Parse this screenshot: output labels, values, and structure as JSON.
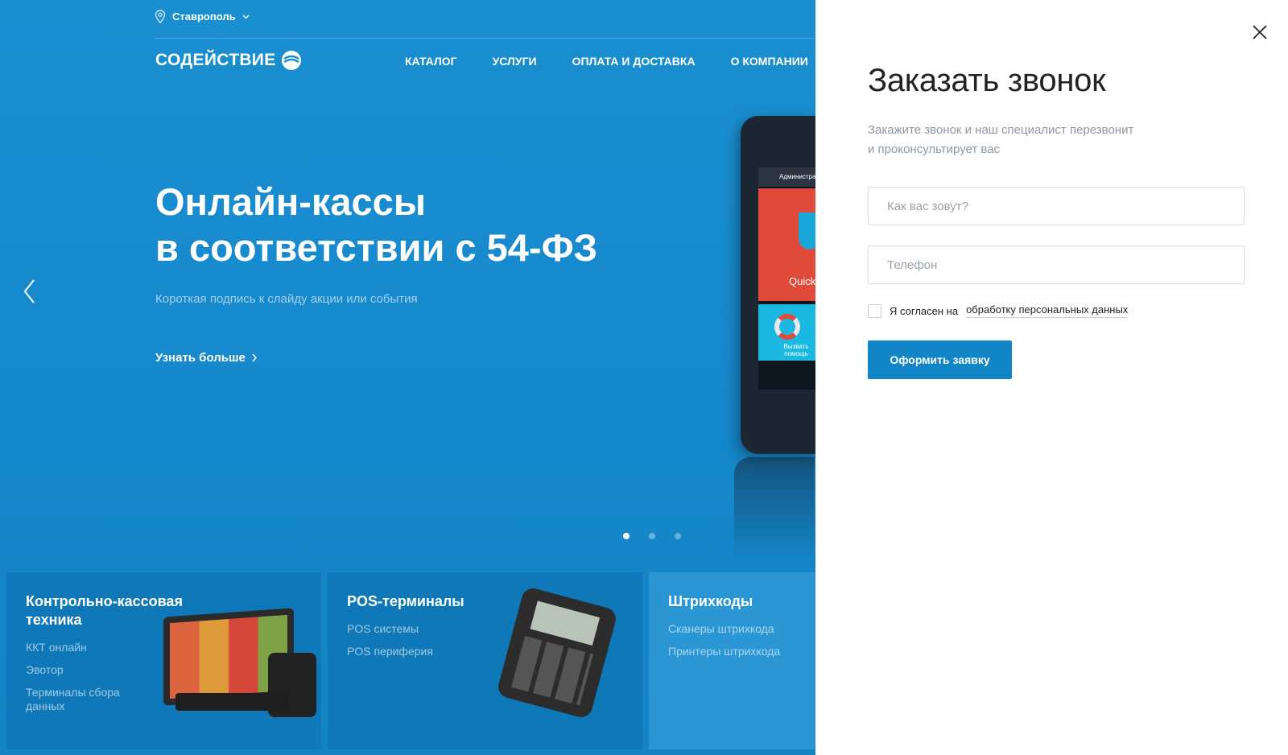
{
  "header": {
    "city": "Ставрополь",
    "logo_text": "СОДЕЙСТВИЕ",
    "nav": [
      "КАТАЛОГ",
      "УСЛУГИ",
      "ОПЛАТА И ДОСТАВКА",
      "О КОМПАНИИ"
    ]
  },
  "hero": {
    "title_line1": "Онлайн-кассы",
    "title_line2": "в соответствии с 54-ФЗ",
    "subtitle": "Короткая подпись к слайду акции или события",
    "link": "Узнать больше",
    "slides_total": 3,
    "slide_active": 1,
    "device": {
      "header_text": "Администратор",
      "tile_red_label": "Quick",
      "tile_blue_label": "Вызвать помощь"
    }
  },
  "categories": [
    {
      "title_line1": "Контрольно-кассовая",
      "title_line2": "техника",
      "links": [
        "ККТ онлайн",
        "Эвотор",
        "Терминалы сбора данных"
      ]
    },
    {
      "title_line1": "POS-терминалы",
      "links": [
        "POS системы",
        "POS периферия"
      ]
    },
    {
      "title_line1": "Штрихкоды",
      "links": [
        "Сканеры штрихкода",
        "Принтеры штрихкода"
      ]
    }
  ],
  "modal": {
    "title": "Заказать звонок",
    "description_line1": "Закажите звонок и наш специалист перезвонит",
    "description_line2": "и проконсультирует вас",
    "name_placeholder": "Как вас зовут?",
    "phone_placeholder": "Телефон",
    "agree_text": "Я согласен на",
    "agree_link": "обработку персональных данных",
    "submit_label": "Оформить заявку",
    "accent_color": "#1185c6"
  }
}
